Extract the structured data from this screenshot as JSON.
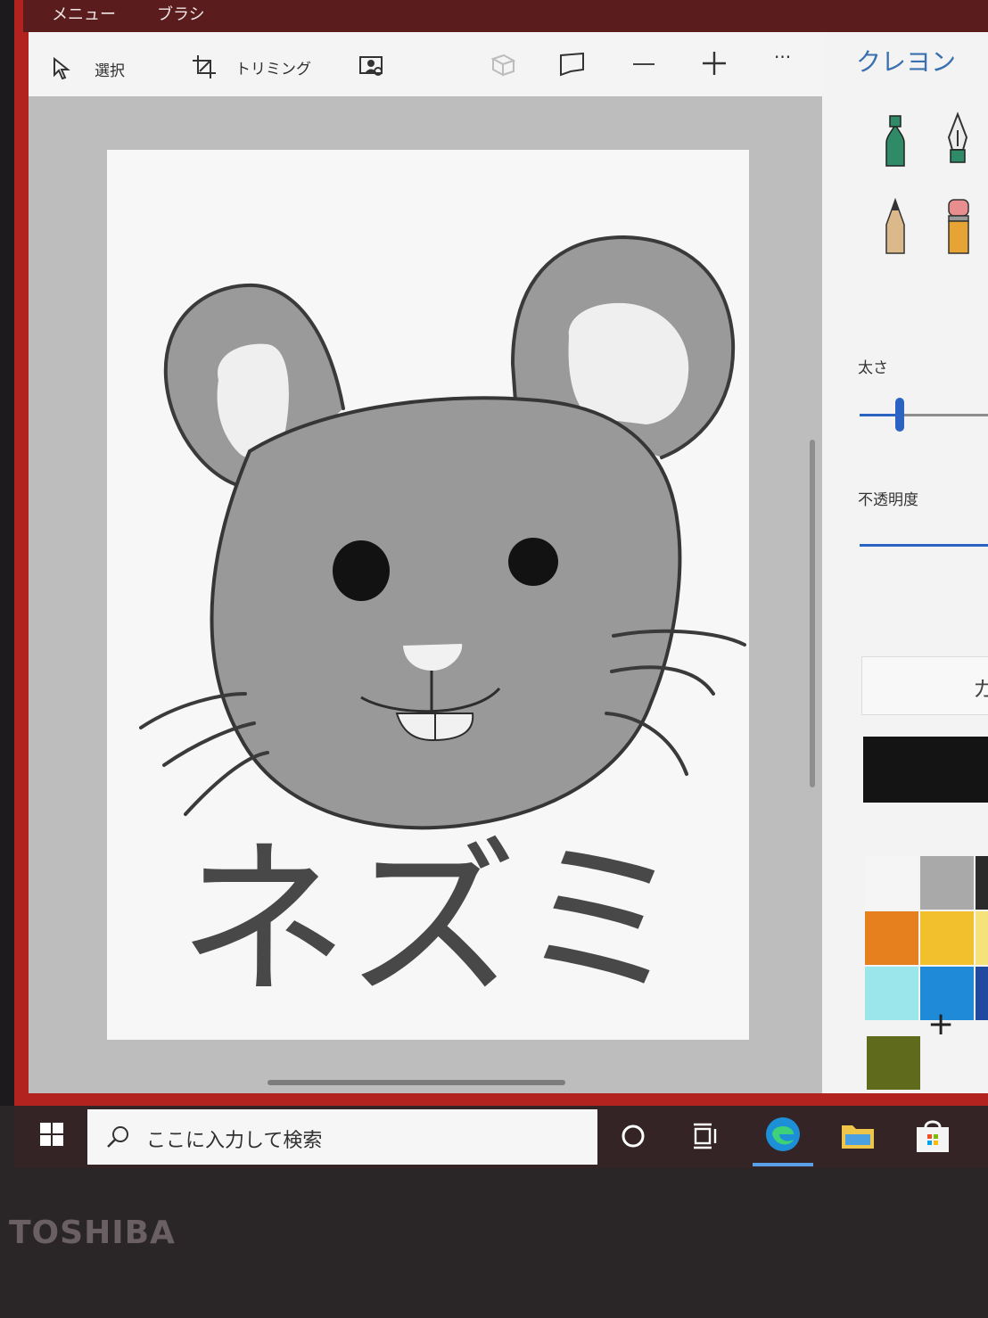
{
  "titlebar": {
    "menu": "メニュー",
    "brush": "ブラシ"
  },
  "toolbar": {
    "select": "選択",
    "crop": "トリミング",
    "more": "···"
  },
  "panel": {
    "title": "クレヨン",
    "thickness_label": "太さ",
    "opacity_label": "不透明度",
    "thickness_level": 0.25,
    "opacity_level": 1.0,
    "custom_partial": "カ",
    "current_color": "#141414",
    "palette": [
      "#f5f5f5",
      "#a9a9a9",
      "#e6801f",
      "#f1c02c",
      "#9be6ea",
      "#1e8ad8"
    ],
    "custom_color": "#5f6a1c",
    "add_label": "+"
  },
  "drawing": {
    "text": "ネズミ"
  },
  "taskbar": {
    "search_placeholder": "ここに入力して検索"
  },
  "device": {
    "brand": "TOSHIBA"
  }
}
